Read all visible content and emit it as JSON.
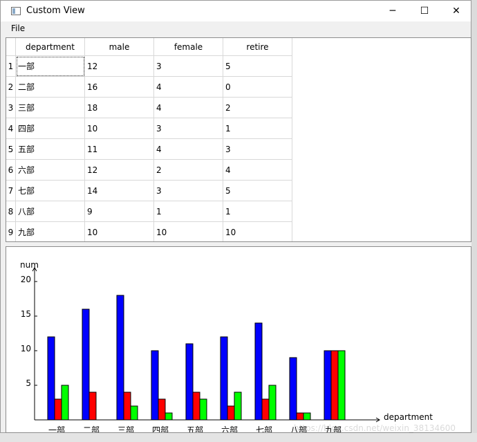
{
  "window": {
    "title": "Custom View",
    "icon": "app-window-icon",
    "controls": {
      "minimize": "─",
      "maximize": "☐",
      "close": "✕"
    }
  },
  "menu": {
    "file": "File"
  },
  "table": {
    "headers": [
      "department",
      "male",
      "female",
      "retire"
    ],
    "rows": [
      {
        "num": "1",
        "cells": [
          "一部",
          "12",
          "3",
          "5"
        ]
      },
      {
        "num": "2",
        "cells": [
          "二部",
          "16",
          "4",
          "0"
        ]
      },
      {
        "num": "3",
        "cells": [
          "三部",
          "18",
          "4",
          "2"
        ]
      },
      {
        "num": "4",
        "cells": [
          "四部",
          "10",
          "3",
          "1"
        ]
      },
      {
        "num": "5",
        "cells": [
          "五部",
          "11",
          "4",
          "3"
        ]
      },
      {
        "num": "6",
        "cells": [
          "六部",
          "12",
          "2",
          "4"
        ]
      },
      {
        "num": "7",
        "cells": [
          "七部",
          "14",
          "3",
          "5"
        ]
      },
      {
        "num": "8",
        "cells": [
          "八部",
          "9",
          "1",
          "1"
        ]
      },
      {
        "num": "9",
        "cells": [
          "九部",
          "10",
          "10",
          "10"
        ]
      }
    ]
  },
  "chart_data": {
    "type": "bar",
    "title": "",
    "xlabel": "department",
    "ylabel": "num",
    "ylim": [
      0,
      20
    ],
    "yticks": [
      5,
      10,
      15,
      20
    ],
    "categories": [
      "一部",
      "二部",
      "三部",
      "四部",
      "五部",
      "六部",
      "七部",
      "八部",
      "九部"
    ],
    "series": [
      {
        "values": [
          12,
          16,
          18,
          10,
          11,
          12,
          14,
          9,
          10
        ],
        "color": "#0000ff"
      },
      {
        "values": [
          3,
          4,
          4,
          3,
          4,
          2,
          3,
          1,
          10
        ],
        "color": "#ff0000"
      },
      {
        "values": [
          5,
          0,
          2,
          1,
          3,
          4,
          5,
          1,
          10
        ],
        "color": "#00ff00"
      }
    ]
  },
  "watermark": "https://blog.csdn.net/weixin_38134600"
}
